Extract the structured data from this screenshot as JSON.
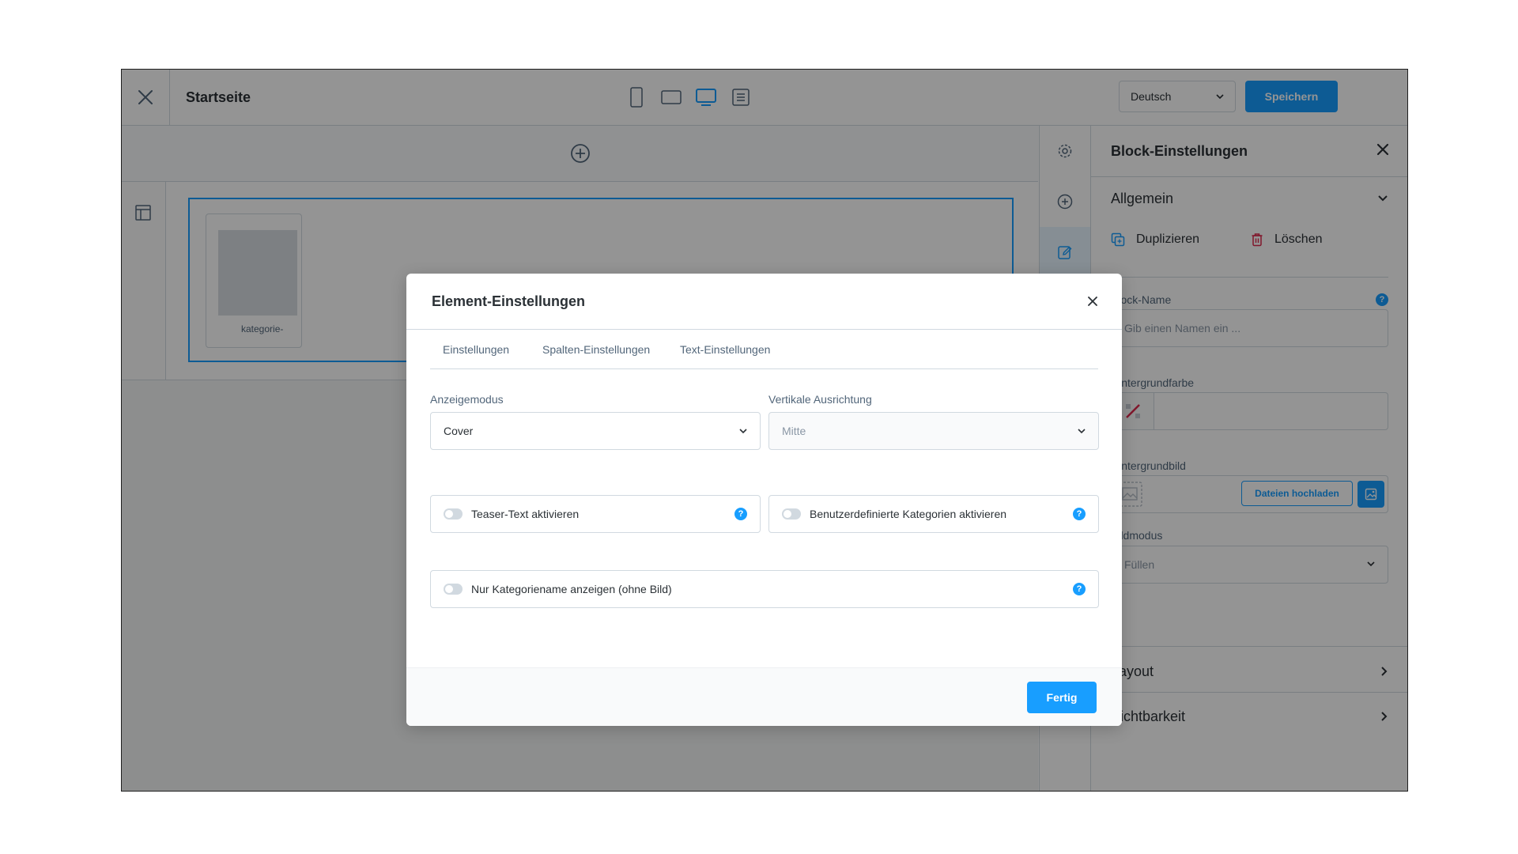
{
  "topbar": {
    "title": "Startseite",
    "language": "Deutsch",
    "save_label": "Speichern"
  },
  "canvas": {
    "category_label": "kategorie-"
  },
  "panel": {
    "title": "Block-Einstellungen",
    "general": "Allgemein",
    "duplicate": "Duplizieren",
    "delete": "Löschen",
    "block_name_label": "Block-Name",
    "block_name_placeholder": "Gib einen Namen ein ...",
    "bg_color_label": "Hintergrundfarbe",
    "bg_image_label": "Hintergrundbild",
    "upload_label": "Dateien hochladen",
    "image_mode_label": "Bildmodus",
    "image_mode_value": "Füllen",
    "layout": "Layout",
    "visibility": "Sichtbarkeit"
  },
  "modal": {
    "title": "Element-Einstellungen",
    "tabs": [
      "Einstellungen",
      "Spalten-Einstellungen",
      "Text-Einstellungen"
    ],
    "display_mode_label": "Anzeigemodus",
    "display_mode_value": "Cover",
    "vertical_align_label": "Vertikale Ausrichtung",
    "vertical_align_value": "Mitte",
    "toggles": [
      "Teaser-Text aktivieren",
      "Benutzerdefinierte Kategorien aktivieren",
      "Nur Kategoriename anzeigen (ohne Bild)"
    ],
    "done_label": "Fertig"
  },
  "colors": {
    "accent": "#189eff",
    "danger": "#de294c"
  }
}
